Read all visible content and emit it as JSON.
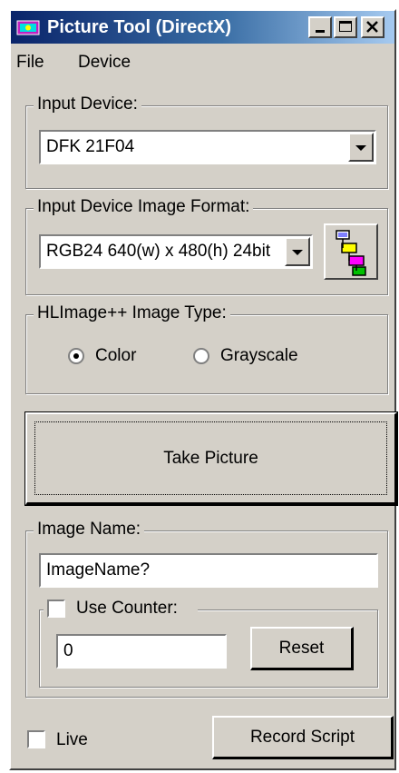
{
  "window": {
    "title": "Picture Tool (DirectX)"
  },
  "menu": {
    "file": "File",
    "device": "Device"
  },
  "input_device": {
    "label": "Input Device:",
    "selected": "DFK 21F04"
  },
  "image_format": {
    "label": "Input Device Image Format:",
    "selected": "RGB24 640(w) x 480(h) 24bit"
  },
  "image_type": {
    "label": "HLImage++ Image Type:",
    "options": [
      "Color",
      "Grayscale"
    ],
    "selected": "Color"
  },
  "take_picture": {
    "label": "Take Picture"
  },
  "image_name": {
    "label": "Image Name:",
    "value": "ImageName?"
  },
  "counter": {
    "label": "Use Counter:",
    "checked": false,
    "value": "0",
    "reset_label": "Reset"
  },
  "live": {
    "label": "Live",
    "checked": false
  },
  "record_script": {
    "label": "Record Script"
  },
  "colors": {
    "titlebar_start": "#0a246a",
    "titlebar_end": "#a6caf0",
    "face": "#d4d0c8"
  }
}
